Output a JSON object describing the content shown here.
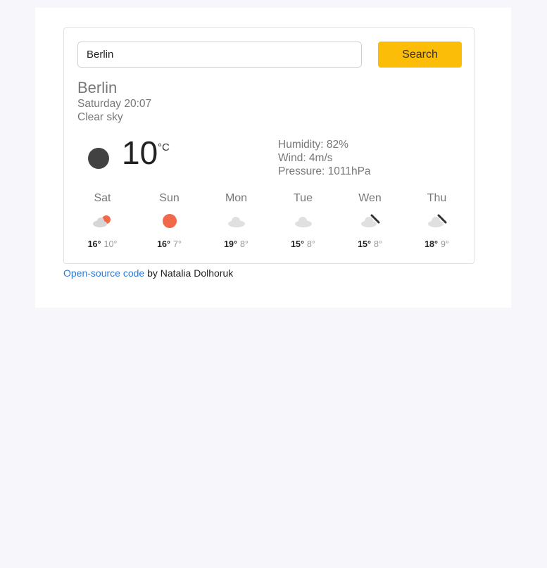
{
  "search": {
    "value": "Berlin",
    "button_label": "Search"
  },
  "current": {
    "city": "Berlin",
    "datetime": "Saturday 20:07",
    "description": "Clear sky",
    "temperature": "10",
    "unit": "°C",
    "icon": "moon-icon",
    "humidity": "Humidity: 82%",
    "wind": "Wind: 4m/s",
    "pressure": "Pressure: 1011hPa"
  },
  "forecast": [
    {
      "day": "Sat",
      "icon": "partly-cloudy-icon",
      "max": "16°",
      "min": "10°"
    },
    {
      "day": "Sun",
      "icon": "sun-icon",
      "max": "16°",
      "min": "7°"
    },
    {
      "day": "Mon",
      "icon": "cloud-icon",
      "max": "19°",
      "min": "8°"
    },
    {
      "day": "Tue",
      "icon": "cloud-icon",
      "max": "15°",
      "min": "8°"
    },
    {
      "day": "Wen",
      "icon": "rain-icon",
      "max": "15°",
      "min": "8°"
    },
    {
      "day": "Thu",
      "icon": "rain-icon",
      "max": "18°",
      "min": "9°"
    }
  ],
  "footer": {
    "link_text": "Open-source code",
    "suffix": " by Natalia Dolhoruk"
  },
  "colors": {
    "accent": "#fbbd08",
    "sun": "#f0694a",
    "link": "#2b7bd8",
    "moon": "#424242"
  }
}
